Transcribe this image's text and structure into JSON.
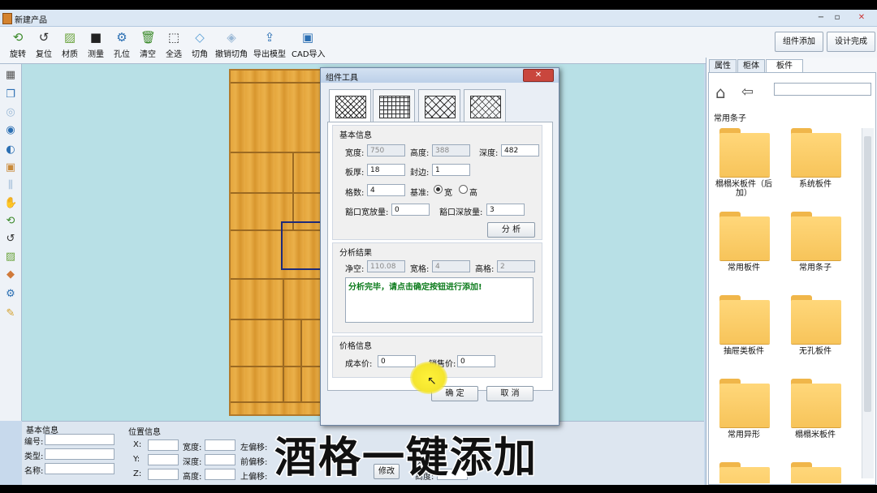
{
  "window": {
    "title": "新建产品",
    "min": "−",
    "max": "▫",
    "close": "✕"
  },
  "toolbar": {
    "items": [
      {
        "label": "旋转",
        "icon": "rotate-icon",
        "glyph": "⟲"
      },
      {
        "label": "复位",
        "icon": "reset-icon",
        "glyph": "↺"
      },
      {
        "label": "材质",
        "icon": "material-icon",
        "glyph": "▨"
      },
      {
        "label": "测量",
        "icon": "measure-icon",
        "glyph": "■"
      },
      {
        "label": "孔位",
        "icon": "hole-icon",
        "glyph": "⚙"
      },
      {
        "label": "清空",
        "icon": "trash-icon",
        "glyph": "🗑"
      },
      {
        "label": "全选",
        "icon": "select-all-icon",
        "glyph": "⬚"
      },
      {
        "label": "切角",
        "icon": "cut-corner-icon",
        "glyph": "◇"
      },
      {
        "label": "撤销切角",
        "icon": "undo-cut-icon",
        "glyph": "◈"
      },
      {
        "label": "导出模型",
        "icon": "export-icon",
        "glyph": "⇪"
      },
      {
        "label": "CAD导入",
        "icon": "cad-import-icon",
        "glyph": "▣"
      }
    ],
    "add_component": "组件添加",
    "design_done": "设计完成"
  },
  "left_tools": [
    "calculator-icon",
    "copy-icon",
    "hide-icon",
    "eye-icon",
    "contrast-icon",
    "image-icon",
    "split-icon",
    "hand-icon",
    "rotate-icon",
    "refresh-icon",
    "texture-icon",
    "shapes-icon",
    "gears-icon",
    "brush-icon"
  ],
  "right_panel": {
    "tabs": [
      "属性",
      "柜体",
      "板件"
    ],
    "active_tab": "板件",
    "search_value": "",
    "section": "常用条子",
    "folders": [
      "榻榻米板件（后加）",
      "系统板件",
      "常用板件",
      "常用条子",
      "抽屉类板件",
      "无孔板件",
      "常用异形",
      "榻榻米板件",
      "",
      ""
    ]
  },
  "bottom": {
    "basic_title": "基本信息",
    "basic_fields": [
      "编号:",
      "类型:",
      "名称:"
    ],
    "pos_title": "位置信息",
    "pos_labels": [
      "X:",
      "Y:",
      "Z:"
    ],
    "size_labels": [
      "宽度:",
      "深度:",
      "高度:"
    ],
    "offset_labels": [
      "左偏移:",
      "前偏移:",
      "上偏移:"
    ],
    "modify": "修改",
    "other_labels": [
      "深度:",
      "高度:"
    ]
  },
  "dialog": {
    "title": "组件工具",
    "close": "✕",
    "basic": {
      "title": "基本信息",
      "width_label": "宽度:",
      "width": "750",
      "height_label": "高度:",
      "height": "388",
      "depth_label": "深度:",
      "depth": "482",
      "thickness_label": "板厚:",
      "thickness": "18",
      "edge_label": "封边:",
      "edge": "1",
      "count_label": "格数:",
      "count": "4",
      "base_label": "基准:",
      "base_wide": "宽",
      "base_high": "高",
      "gap_w_label": "豁口宽放量:",
      "gap_w": "0",
      "gap_d_label": "豁口深放量:",
      "gap_d": "3",
      "analyze": "分 析"
    },
    "result": {
      "title": "分析结果",
      "net_label": "净空:",
      "net": "110.08",
      "wide_label": "宽格:",
      "wide": "4",
      "high_label": "高格:",
      "high": "2",
      "message": "分析完毕，请点击确定按钮进行添加!"
    },
    "price": {
      "title": "价格信息",
      "cost_label": "成本价:",
      "cost": "0",
      "sale_label": "销售价:",
      "sale": "0"
    },
    "ok": "确 定",
    "cancel": "取 消"
  },
  "caption": "酒格一键添加"
}
